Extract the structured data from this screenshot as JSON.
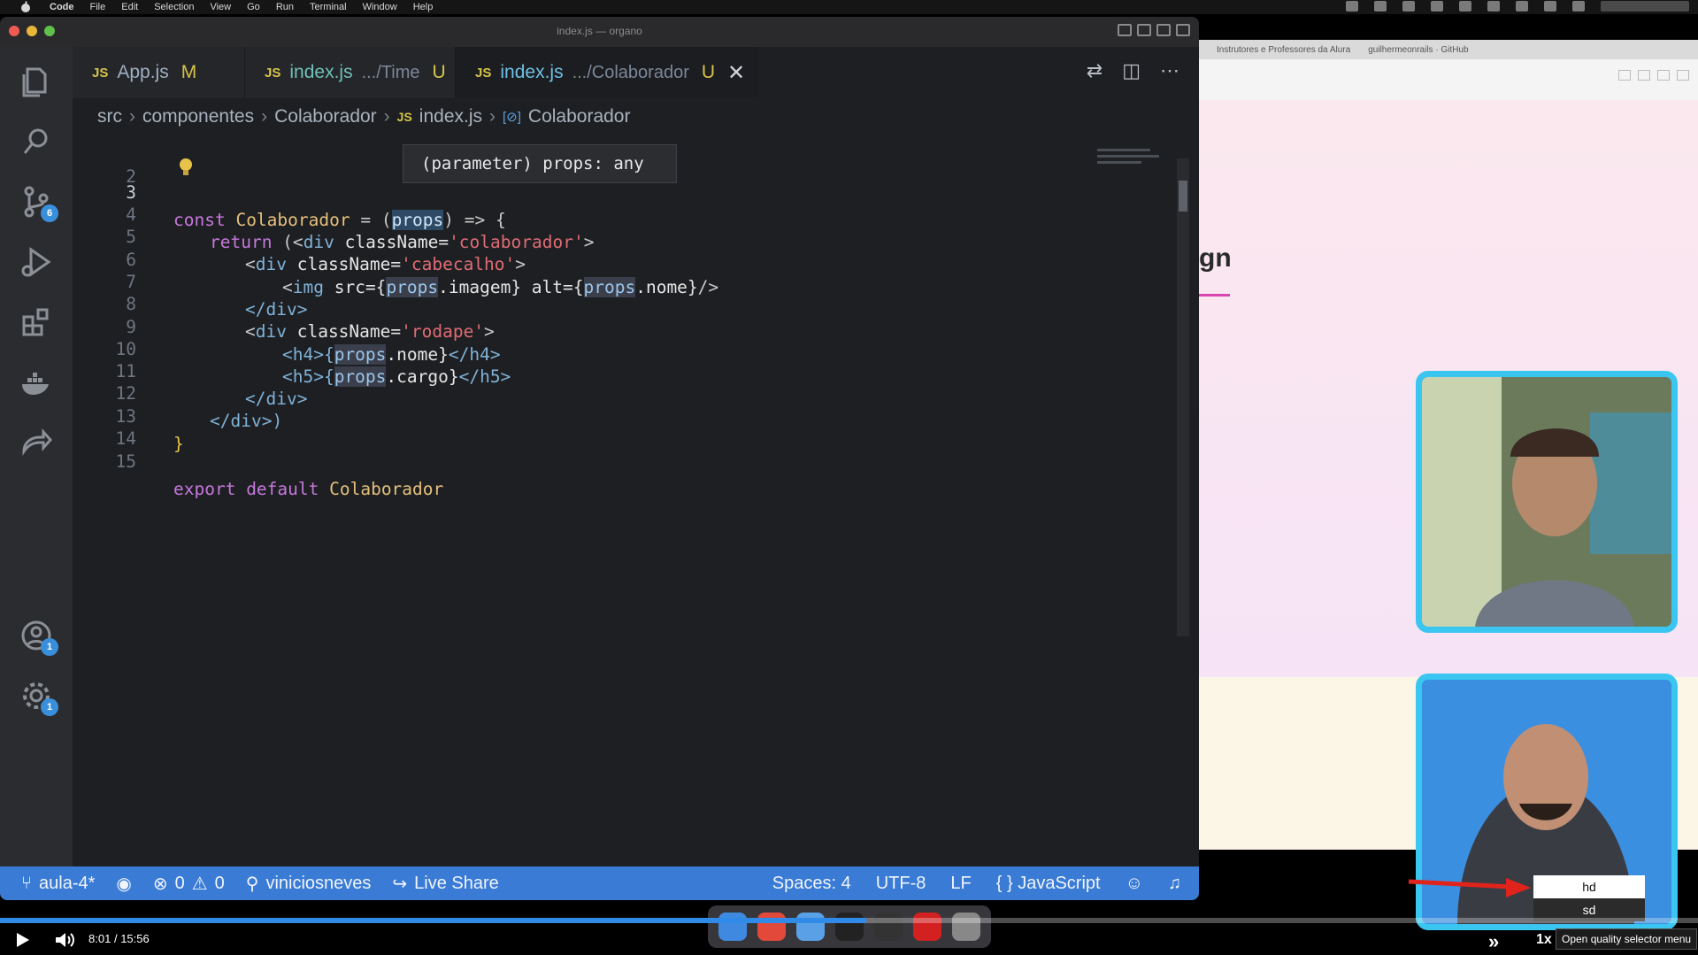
{
  "mac_menu": {
    "items": [
      "Code",
      "File",
      "Edit",
      "Selection",
      "View",
      "Go",
      "Run",
      "Terminal",
      "Window",
      "Help"
    ]
  },
  "window": {
    "title": "index.js — organo"
  },
  "tabs": [
    {
      "lang": "JS",
      "name": "App.js",
      "path": "",
      "flag": "M"
    },
    {
      "lang": "JS",
      "name": "index.js",
      "path": ".../Time",
      "flag": "U"
    },
    {
      "lang": "JS",
      "name": "index.js",
      "path": ".../Colaborador",
      "flag": "U",
      "close": "✕"
    }
  ],
  "breadcrumb": {
    "items": [
      "src",
      "componentes",
      "Colaborador"
    ],
    "file_lang": "JS",
    "file": "index.js",
    "symbol_icon": "[⊘]",
    "symbol": "Colaborador"
  },
  "hover": {
    "text": "(parameter) props: any"
  },
  "code": {
    "line_numbers": [
      "2",
      "3",
      "4",
      "5",
      "6",
      "7",
      "8",
      "9",
      "10",
      "11",
      "12",
      "13",
      "14",
      "15"
    ],
    "line3": {
      "kw": "const",
      "name": "Colaborador",
      "eq": " = (",
      "param": "props",
      "arrow": ") => {"
    },
    "line4": {
      "kw": "return",
      "open": " (<",
      "tag": "div",
      "attr": " className=",
      "str": "'colaborador'",
      "close": ">"
    },
    "line5": {
      "open": "<",
      "tag": "div",
      "attr": " className=",
      "str": "'cabecalho'",
      "close": ">"
    },
    "line6": {
      "open": "<",
      "tag": "img",
      "attr1": " src={",
      "p1": "props",
      "v1": ".imagem}",
      "attr2": " alt={",
      "p2": "props",
      "v2": ".nome}",
      "close": "/>"
    },
    "line7": {
      "text": "</div>"
    },
    "line8": {
      "open": "<",
      "tag": "div",
      "attr": " className=",
      "str": "'rodape'",
      "close": ">"
    },
    "line9": {
      "open": "<h4>{",
      "p": "props",
      "v": ".nome}",
      "close": "</h4>"
    },
    "line10": {
      "open": "<h5>{",
      "p": "props",
      "v": ".cargo}",
      "close": "</h5>"
    },
    "line11": {
      "text": "</div>"
    },
    "line12": {
      "text": "</div>)"
    },
    "line13": {
      "text": "}"
    },
    "line15": {
      "kw1": "export",
      "kw2": " default",
      "name": " Colaborador"
    }
  },
  "status": {
    "branch": "aula-4*",
    "errors": "0",
    "warnings": "0",
    "user": "viniciosneves",
    "live_share": "Live Share",
    "spaces": "Spaces: 4",
    "encoding": "UTF-8",
    "eol": "LF",
    "language_icon": "{ }",
    "language": "JavaScript"
  },
  "activity_badges": {
    "source_control": "6",
    "accounts": "1",
    "settings": "1"
  },
  "browser": {
    "tab1": "Instrutores e Professores da Alura",
    "tab2": "guilhermeonrails · GitHub",
    "heading_fragment": "gn"
  },
  "quality_menu": {
    "options": [
      "hd",
      "sd"
    ],
    "selected": "hd",
    "tooltip": "Open quality selector menu"
  },
  "player": {
    "current": "8:01",
    "separator": "/",
    "duration": "15:56",
    "speed": "1x",
    "progress": 0.51
  },
  "colors": {
    "accent": "#3a7bd5",
    "webcam_border": "#3ac6f0",
    "progress": "#2f8ae8",
    "arrow": "#e0241c"
  }
}
